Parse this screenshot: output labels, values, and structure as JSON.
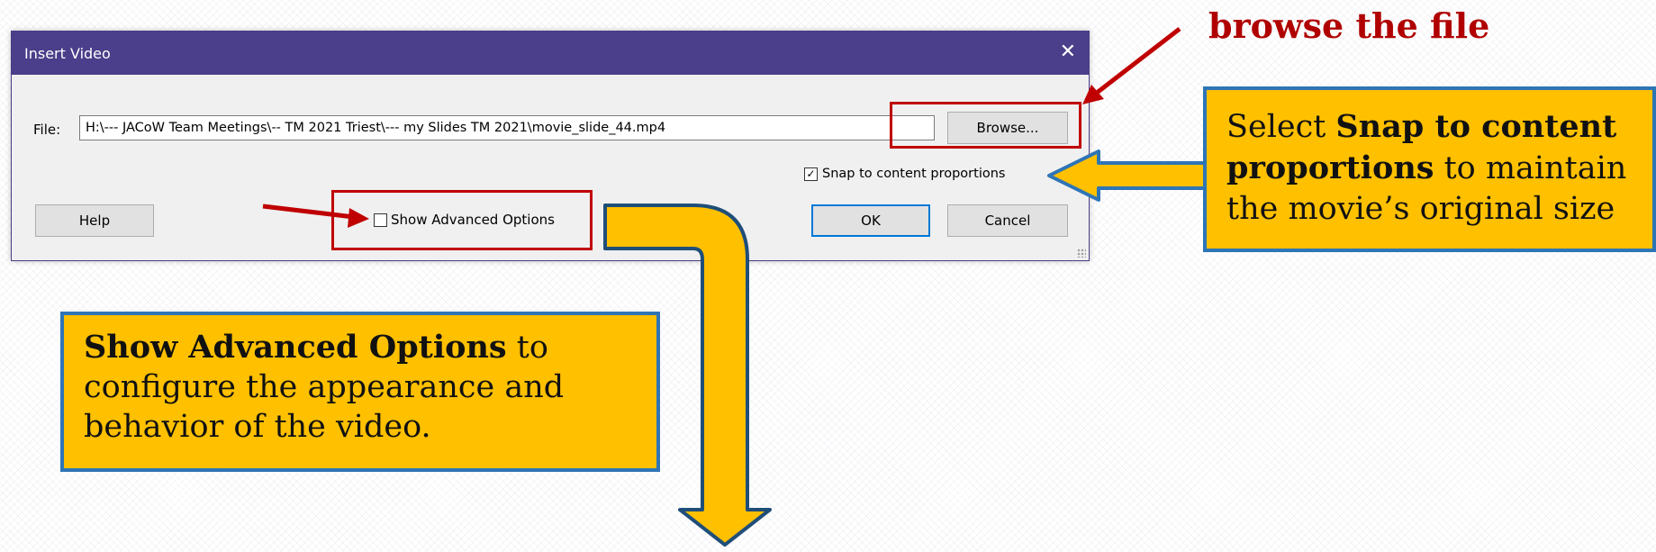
{
  "dialog": {
    "title": "Insert Video",
    "file_label": "File:",
    "file_value": "H:\\--- JACoW Team Meetings\\-- TM 2021 Triest\\--- my Slides TM 2021\\movie_slide_44.mp4",
    "browse_label": "Browse...",
    "snap_label": "Snap to content proportions",
    "snap_checked": true,
    "advanced_label": "Show Advanced Options",
    "advanced_checked": false,
    "help_label": "Help",
    "ok_label": "OK",
    "cancel_label": "Cancel"
  },
  "annotations": {
    "browse_title": "browse the file",
    "snap_callout": {
      "prefix": "Select ",
      "bold": "Snap to content proportions",
      "suffix": " to maintain the movie’s original size"
    },
    "advanced_callout": {
      "bold": "Show Advanced Options",
      "suffix": " to configure the appearance and behavior of the video."
    }
  },
  "colors": {
    "titlebar": "#4b3e8a",
    "highlight_red": "#c00000",
    "callout_fill": "#ffc000",
    "callout_border": "#2e75b6",
    "arrow_red": "#b00000"
  }
}
